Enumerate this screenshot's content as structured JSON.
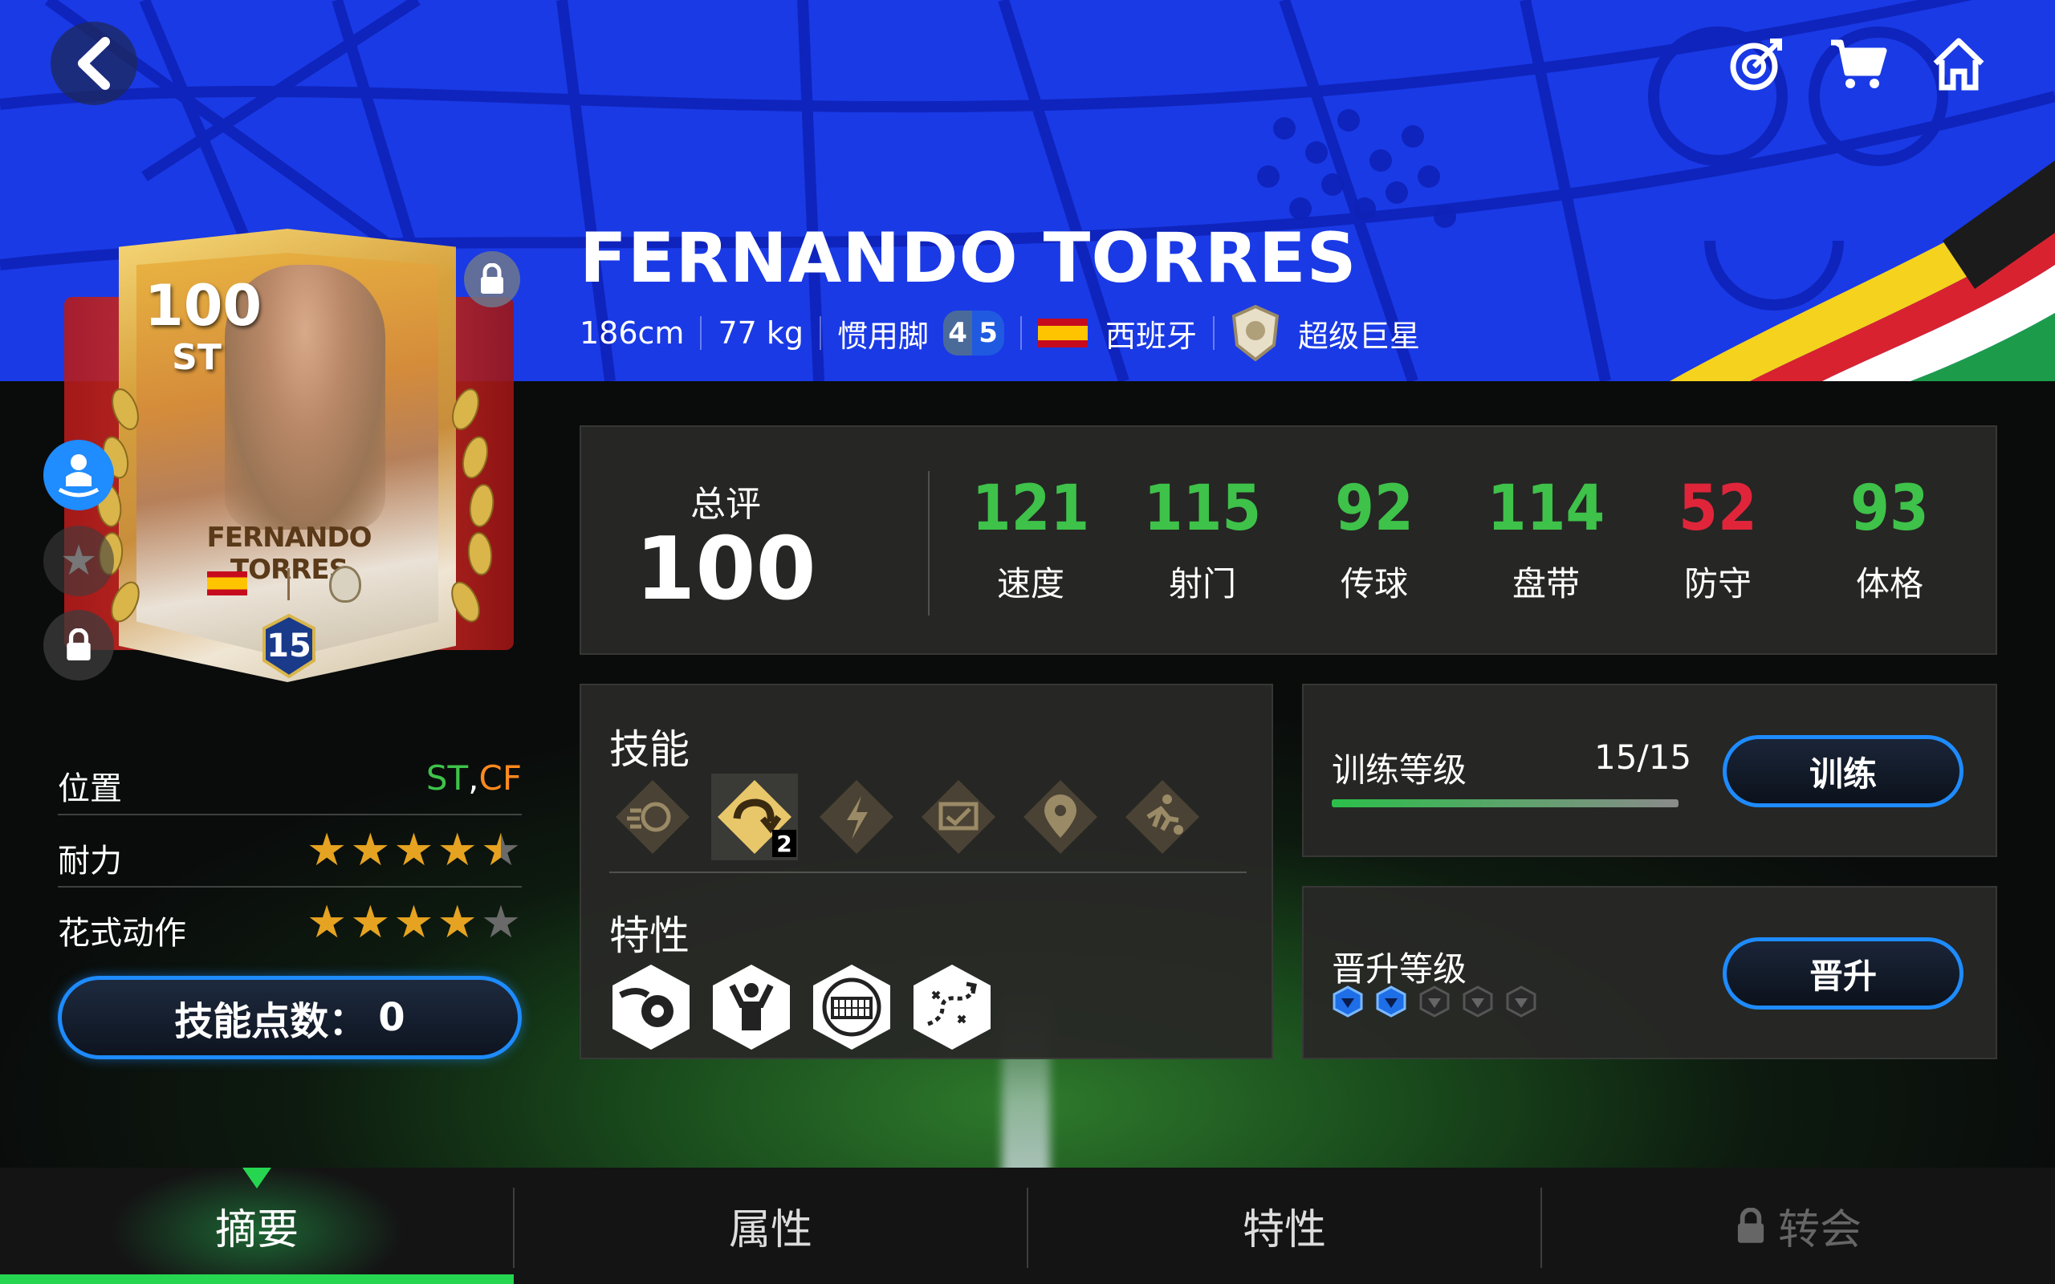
{
  "header": {
    "player_name": "FERNANDO TORRES",
    "height": "186cm",
    "weight": "77 kg",
    "foot_label": "惯用脚",
    "weak_foot": "4",
    "strong_foot": "5",
    "nation": "西班牙",
    "tier": "超级巨星",
    "icons": [
      "back-icon",
      "target-icon",
      "cart-icon",
      "home-icon"
    ]
  },
  "card": {
    "rating": "100",
    "position": "ST",
    "name": "FERNANDO TORRES",
    "level": "15"
  },
  "left_info": {
    "position_label": "位置",
    "position_primary": "ST",
    "position_comma": ",",
    "position_secondary": "CF",
    "stamina_label": "耐力",
    "stamina_stars": 4.5,
    "skill_moves_label": "花式动作",
    "skill_moves_stars": 4,
    "skill_points_label": "技能点数：",
    "skill_points_value": "0"
  },
  "overall": {
    "label": "总评",
    "value": "100",
    "attributes": [
      {
        "value": "121",
        "label": "速度",
        "color": "#3ec24a"
      },
      {
        "value": "115",
        "label": "射门",
        "color": "#3ec24a"
      },
      {
        "value": "92",
        "label": "传球",
        "color": "#3ec24a"
      },
      {
        "value": "114",
        "label": "盘带",
        "color": "#3ec24a"
      },
      {
        "value": "52",
        "label": "防守",
        "color": "#e0253a"
      },
      {
        "value": "93",
        "label": "体格",
        "color": "#3ec24a"
      }
    ]
  },
  "skills": {
    "title": "技能",
    "active_badge": "2",
    "trait_title": "特性",
    "skill_icons": [
      "shot-skill-icon",
      "curve-skill-icon",
      "power-skill-icon",
      "screen-skill-icon",
      "location-skill-icon",
      "run-skill-icon"
    ],
    "trait_icons": [
      "power-shot-trait-icon",
      "celebrate-trait-icon",
      "goal-net-trait-icon",
      "dribble-path-trait-icon"
    ]
  },
  "training": {
    "label": "训练等级",
    "value": "15/15",
    "progress": 1.0,
    "button": "训练"
  },
  "promotion": {
    "label": "晋升等级",
    "filled": 2,
    "total": 5,
    "button": "晋升"
  },
  "tabs": [
    {
      "label": "摘要",
      "active": true,
      "locked": false
    },
    {
      "label": "属性",
      "active": false,
      "locked": false
    },
    {
      "label": "特性",
      "active": false,
      "locked": false
    },
    {
      "label": "转会",
      "active": false,
      "locked": true
    }
  ],
  "colors": {
    "accent_blue": "#1e8bff",
    "header_blue": "#1a3ae6",
    "stat_green": "#3ec24a",
    "stat_red": "#e0253a",
    "tab_green": "#27d650",
    "position_secondary": "#ff8a1e"
  }
}
